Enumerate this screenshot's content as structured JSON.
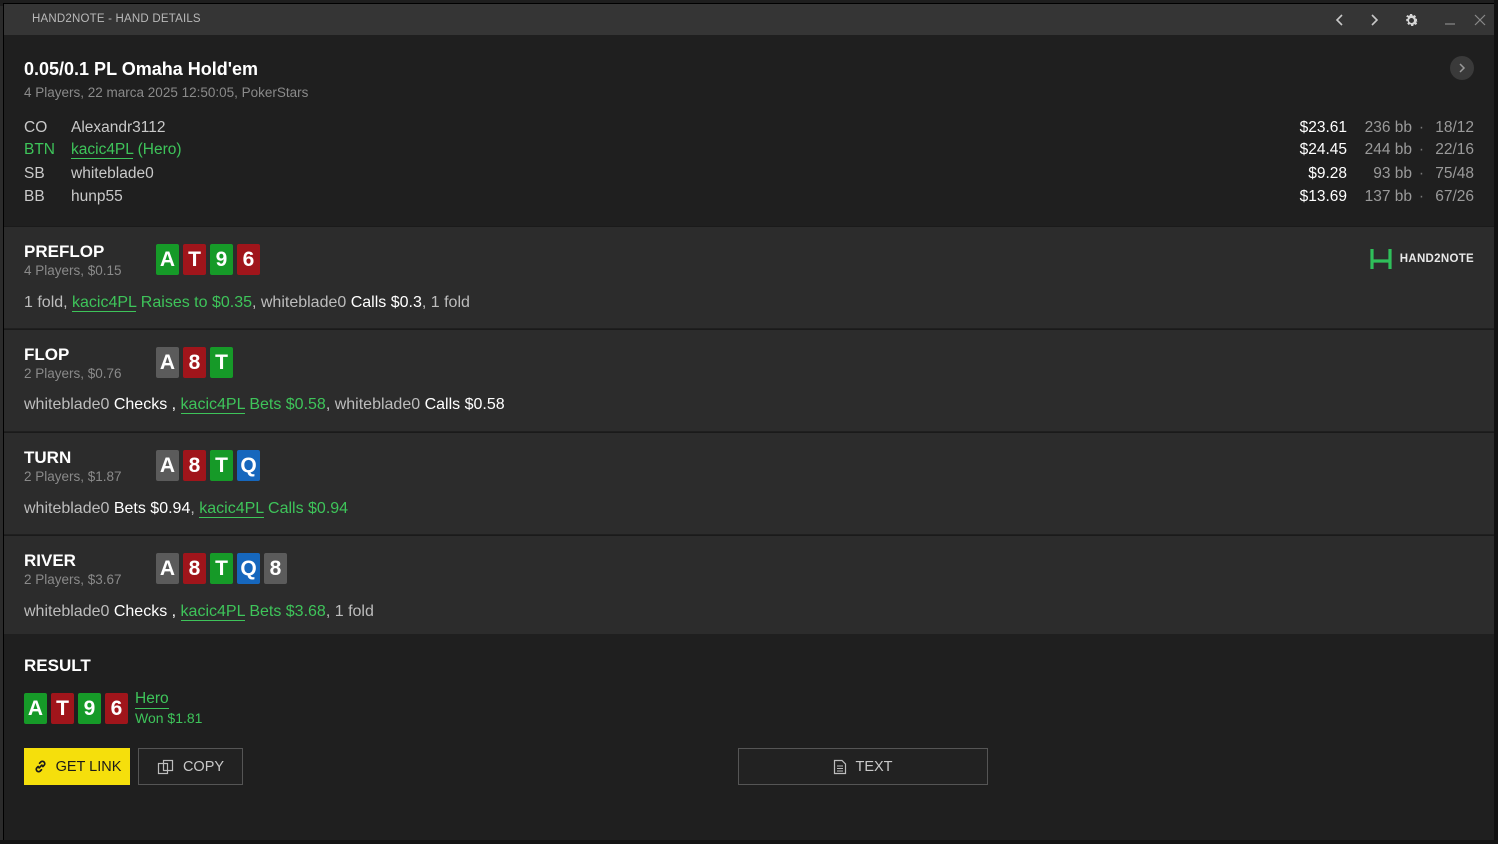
{
  "window": {
    "title": "HAND2NOTE - HAND DETAILS"
  },
  "hand": {
    "title": "0.05/0.1 PL Omaha Hold'em",
    "subtitle": "4 Players, 22 marca 2025 12:50:05, PokerStars"
  },
  "players": [
    {
      "pos": "CO",
      "name": "Alexandr3112",
      "hero_suffix": "",
      "stack": "$23.61",
      "bb": "236 bb",
      "dot": "·",
      "stat": "18/12",
      "is_hero": false
    },
    {
      "pos": "BTN",
      "name": "kacic4PL",
      "hero_suffix": " (Hero)",
      "stack": "$24.45",
      "bb": "244 bb",
      "dot": "·",
      "stat": "22/16",
      "is_hero": true
    },
    {
      "pos": "SB",
      "name": "whiteblade0",
      "hero_suffix": "",
      "stack": "$9.28",
      "bb": "93 bb",
      "dot": "·",
      "stat": "75/48",
      "is_hero": false
    },
    {
      "pos": "BB",
      "name": "hunp55",
      "hero_suffix": "",
      "stack": "$13.69",
      "bb": "137 bb",
      "dot": "·",
      "stat": "67/26",
      "is_hero": false
    }
  ],
  "logo": {
    "text": "HAND2NOTE"
  },
  "streets": {
    "preflop": {
      "name": "PREFLOP",
      "info": "4 Players, $0.15",
      "cards": [
        {
          "rank": "A",
          "suit": "club"
        },
        {
          "rank": "T",
          "suit": "heart"
        },
        {
          "rank": "9",
          "suit": "club"
        },
        {
          "rank": "6",
          "suit": "heart"
        }
      ],
      "action": {
        "t1": "1 fold, ",
        "hero": "kacic4PL",
        "t2": " Raises to $0.35",
        "t3": ", whiteblade0 ",
        "t4": "Calls $0.3",
        "t5": ", 1 fold"
      }
    },
    "flop": {
      "name": "FLOP",
      "info": "2 Players, $0.76",
      "cards": [
        {
          "rank": "A",
          "suit": "spade"
        },
        {
          "rank": "8",
          "suit": "heart"
        },
        {
          "rank": "T",
          "suit": "club"
        }
      ],
      "action": {
        "t1": "whiteblade0 ",
        "t2": "Checks",
        "t3": " , ",
        "hero": "kacic4PL",
        "t4": " Bets $0.58",
        "t5": ", whiteblade0 ",
        "t6": "Calls $0.58"
      }
    },
    "turn": {
      "name": "TURN",
      "info": "2 Players, $1.87",
      "cards": [
        {
          "rank": "A",
          "suit": "spade"
        },
        {
          "rank": "8",
          "suit": "heart"
        },
        {
          "rank": "T",
          "suit": "club"
        },
        {
          "rank": "Q",
          "suit": "diamond"
        }
      ],
      "action": {
        "t1": "whiteblade0 ",
        "t2": "Bets $0.94",
        "t3": ", ",
        "hero": "kacic4PL",
        "t4": " Calls $0.94"
      }
    },
    "river": {
      "name": "RIVER",
      "info": "2 Players, $3.67",
      "cards": [
        {
          "rank": "A",
          "suit": "spade"
        },
        {
          "rank": "8",
          "suit": "heart"
        },
        {
          "rank": "T",
          "suit": "club"
        },
        {
          "rank": "Q",
          "suit": "diamond"
        },
        {
          "rank": "8",
          "suit": "spade"
        }
      ],
      "action": {
        "t1": "whiteblade0 ",
        "t2": "Checks",
        "t3": " , ",
        "hero": "kacic4PL",
        "t4": " Bets $3.68",
        "t5": ", 1 fold"
      }
    }
  },
  "result": {
    "title": "RESULT",
    "cards": [
      {
        "rank": "A",
        "suit": "club"
      },
      {
        "rank": "T",
        "suit": "heart"
      },
      {
        "rank": "9",
        "suit": "club"
      },
      {
        "rank": "6",
        "suit": "heart"
      }
    ],
    "hero": "Hero",
    "won": "Won $1.81"
  },
  "buttons": {
    "get_link": "GET LINK",
    "copy": "COPY",
    "text": "TEXT"
  },
  "colors": {
    "accent_green": "#3ec45a",
    "accent_yellow": "#f5df0c",
    "spade": "#5b5b5b",
    "heart": "#a0151b",
    "club": "#169a28",
    "diamond": "#1667bd"
  }
}
